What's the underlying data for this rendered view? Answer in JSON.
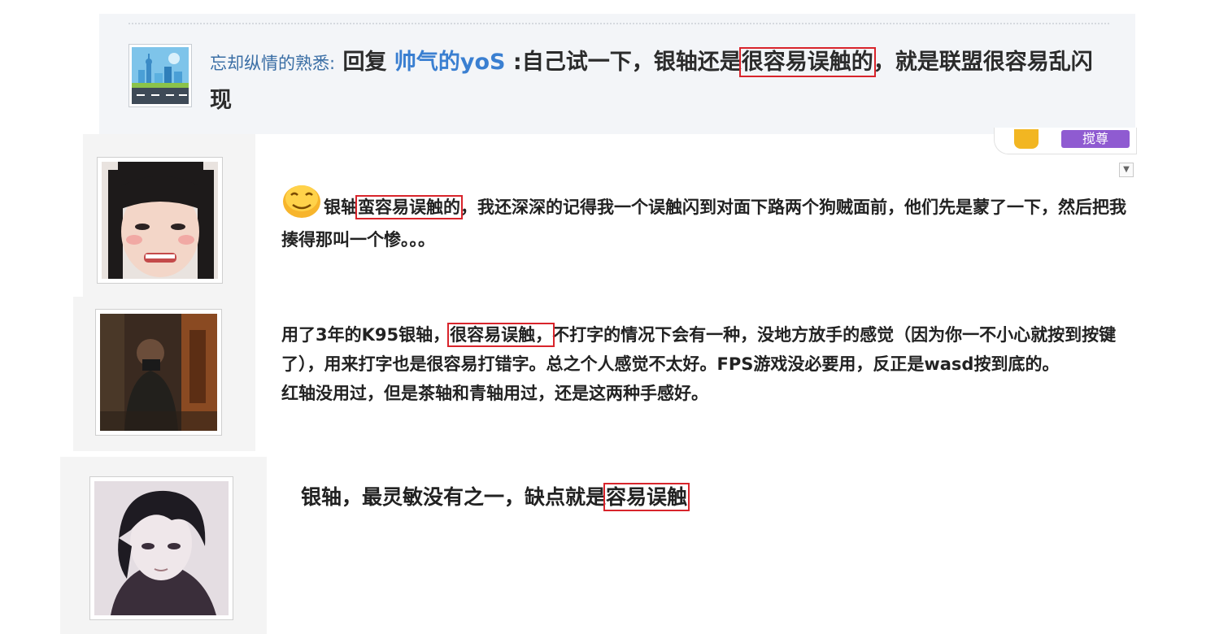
{
  "reply": {
    "username": "忘却纵情的熟悉:",
    "reply_tag": "回复",
    "target_user": "帅气的yoS",
    "text_before": ":自己试一下，银轴还是",
    "highlight": "很容易误触的",
    "text_after": "，就是联盟很容易乱闪现"
  },
  "badges": {
    "purple_label": "搅尊"
  },
  "comments": [
    {
      "emoji": "smiley-icon",
      "lead": "银轴",
      "highlight": "蛮容易误触的",
      "rest": "，我还深深的记得我一个误触闪到对面下路两个狗贼面前，他们先是蒙了一下，然后把我揍得那叫一个惨。。。"
    },
    {
      "lead": "用了3年的K95银轴，",
      "highlight": "很容易误触，",
      "rest": "不打字的情况下会有一种，没地方放手的感觉（因为你一不小心就按到按键了），用来打字也是很容易打错字。总之个人感觉不太好。FPS游戏没必要用，反正是wasd按到底的。",
      "line2": "红轴没用过，但是茶轴和青轴用过，还是这两种手感好。"
    },
    {
      "lead": "银轴，最灵敏没有之一，缺点就是",
      "highlight": "容易误触"
    }
  ],
  "colors": {
    "highlight_border": "#d8242b",
    "username": "#3a6ea5",
    "target_user": "#3a7fd1",
    "panel_bg": "#f3f5f8"
  }
}
